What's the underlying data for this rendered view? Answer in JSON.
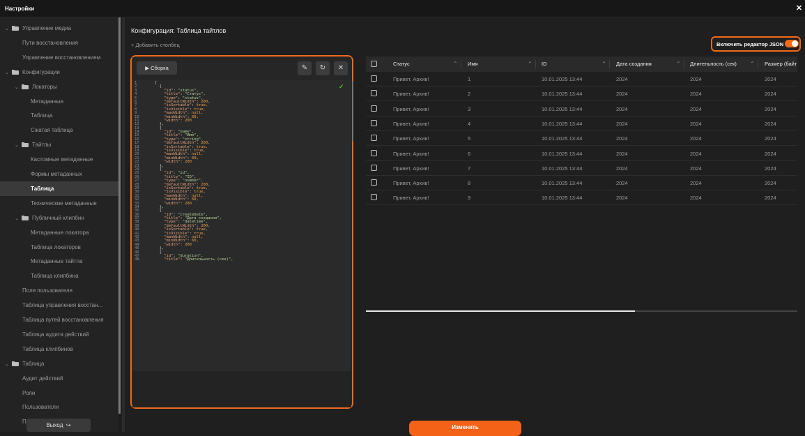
{
  "window": {
    "title": "Настройки"
  },
  "sidebar": {
    "items": [
      {
        "label": "Управление медиа",
        "level": 0,
        "folder": true,
        "expanded": true
      },
      {
        "label": "Пути восстановления",
        "level": 1
      },
      {
        "label": "Управление восстановлением",
        "level": 1
      },
      {
        "label": "Конфигурации",
        "level": 0,
        "folder": true,
        "expanded": true
      },
      {
        "label": "Локаторы",
        "level": 1,
        "folder": true,
        "expanded": true
      },
      {
        "label": "Метаданные",
        "level": 2
      },
      {
        "label": "Таблица",
        "level": 2
      },
      {
        "label": "Сжатая таблица",
        "level": 2
      },
      {
        "label": "Тайтлы",
        "level": 1,
        "folder": true,
        "expanded": true
      },
      {
        "label": "Кастомные метаданные",
        "level": 2
      },
      {
        "label": "Формы метаданных",
        "level": 2
      },
      {
        "label": "Таблица",
        "level": 2,
        "active": true
      },
      {
        "label": "Технические метаданные",
        "level": 2
      },
      {
        "label": "Публичный клипбин",
        "level": 1,
        "folder": true,
        "expanded": true
      },
      {
        "label": "Метаданные локатора",
        "level": 2
      },
      {
        "label": "Таблица локаторов",
        "level": 2
      },
      {
        "label": "Метаданные тайтла",
        "level": 2
      },
      {
        "label": "Таблица клипбина",
        "level": 2
      },
      {
        "label": "Поля пользователя",
        "level": 1
      },
      {
        "label": "Таблица управления восстан...",
        "level": 1
      },
      {
        "label": "Таблица путей восстановления",
        "level": 1
      },
      {
        "label": "Таблица аудита действий",
        "level": 1
      },
      {
        "label": "Таблица клипбинов",
        "level": 1
      },
      {
        "label": "Таблица",
        "level": 0,
        "folder": true,
        "expanded": true
      },
      {
        "label": "Аудит действий",
        "level": 1
      },
      {
        "label": "Роли",
        "level": 1
      },
      {
        "label": "Пользователи",
        "level": 1
      },
      {
        "label": "Пресеты поиска",
        "level": 1
      }
    ],
    "exit_label": "Выход"
  },
  "main": {
    "title": "Конфигурация: Таблица тайтлов",
    "add_column_label": "+ Добавить столбец",
    "json_toggle_label": "Включить редактор JSON",
    "json_toggle_on": true,
    "change_button_label": "Изменить"
  },
  "editor": {
    "build_label": "Сборка",
    "icons": [
      "pencil-icon",
      "reset-icon",
      "close-icon"
    ],
    "valid": true,
    "lines": [
      "[",
      "  {",
      "    \"id\": \"status\",",
      "    \"title\": \"Статус\",",
      "    \"type\": \"status\",",
      "    \"defaultWidth\": 200,",
      "    \"isSortable\": true,",
      "    \"isVisible\": true,",
      "    \"maxWidth\": null,",
      "    \"minWidth\": 60,",
      "    \"width\": 200",
      "  },",
      "  {",
      "    \"id\": \"name\",",
      "    \"title\": \"Имя\",",
      "    \"type\": \"string\",",
      "    \"defaultWidth\": 200,",
      "    \"isSortable\": true,",
      "    \"isVisible\": true,",
      "    \"maxWidth\": null,",
      "    \"minWidth\": 60,",
      "    \"width\": 200",
      "  },",
      "  {",
      "    \"id\": \"id\",",
      "    \"title\": \"ID\",",
      "    \"type\": \"number\",",
      "    \"defaultWidth\": 200,",
      "    \"isSortable\": true,",
      "    \"isVisible\": true,",
      "    \"maxWidth\": null,",
      "    \"minWidth\": 60,",
      "    \"width\": 200",
      "  },",
      "  {",
      "    \"id\": \"createDate\",",
      "    \"title\": \"Дата создания\",",
      "    \"type\": \"datetime\",",
      "    \"defaultWidth\": 200,",
      "    \"isSortable\": true,",
      "    \"isVisible\": true,",
      "    \"maxWidth\": null,",
      "    \"minWidth\": 60,",
      "    \"width\": 200",
      "  },",
      "  {",
      "    \"id\": \"duration\",",
      "    \"title\": \"Длительность (сек)\","
    ]
  },
  "table": {
    "columns": [
      "Статус",
      "Имя",
      "ID",
      "Дата создания",
      "Длительность (сек)",
      "Размер (байт"
    ],
    "rows": [
      [
        "Привет, Архив!",
        "1",
        "10.01.2025 13:44",
        "2024",
        "2024",
        "2024"
      ],
      [
        "Привет, Архив!",
        "2",
        "10.01.2025 13:44",
        "2024",
        "2024",
        "2024"
      ],
      [
        "Привет, Архив!",
        "3",
        "10.01.2025 13:44",
        "2024",
        "2024",
        "2024"
      ],
      [
        "Привет, Архив!",
        "4",
        "10.01.2025 13:44",
        "2024",
        "2024",
        "2024"
      ],
      [
        "Привет, Архив!",
        "5",
        "10.01.2025 13:44",
        "2024",
        "2024",
        "2024"
      ],
      [
        "Привет, Архив!",
        "6",
        "10.01.2025 13:44",
        "2024",
        "2024",
        "2024"
      ],
      [
        "Привет, Архив!",
        "7",
        "10.01.2025 13:44",
        "2024",
        "2024",
        "2024"
      ],
      [
        "Привет, Архив!",
        "8",
        "10.01.2025 13:44",
        "2024",
        "2024",
        "2024"
      ],
      [
        "Привет, Архив!",
        "9",
        "10.01.2025 13:44",
        "2024",
        "2024",
        "2024"
      ]
    ]
  },
  "colors": {
    "accent": "#f46217",
    "background": "#1e1e1e",
    "success": "#52c41a"
  }
}
